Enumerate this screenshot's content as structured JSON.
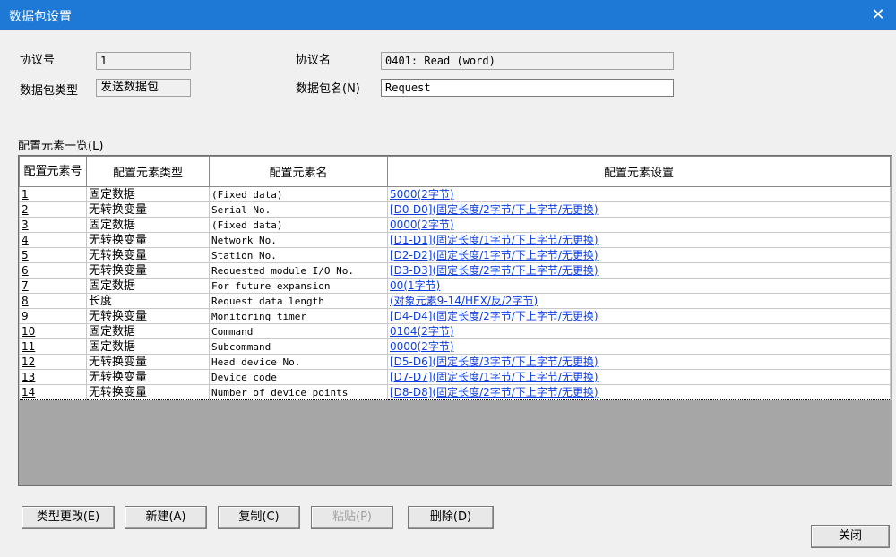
{
  "window": {
    "title": "数据包设置",
    "close_glyph": "✕"
  },
  "protocol_no": {
    "label": "协议号",
    "value": "1"
  },
  "protocol_name": {
    "label": "协议名",
    "value": "0401: Read (word)"
  },
  "packet_type": {
    "label": "数据包类型",
    "value": "发送数据包"
  },
  "packet_name": {
    "label": "数据包名(N)",
    "value": "Request"
  },
  "element_list": {
    "label": "配置元素一览(L)",
    "columns": [
      "配置元素号",
      "配置元素类型",
      "配置元素名",
      "配置元素设置"
    ],
    "rows": [
      {
        "no": "1",
        "type": "固定数据",
        "name": "(Fixed data)",
        "setting": "5000(2字节)"
      },
      {
        "no": "2",
        "type": "无转换变量",
        "name": "Serial No.",
        "setting": "[D0-D0](固定长度/2字节/下上字节/无更换)"
      },
      {
        "no": "3",
        "type": "固定数据",
        "name": "(Fixed data)",
        "setting": "0000(2字节)"
      },
      {
        "no": "4",
        "type": "无转换变量",
        "name": "Network No.",
        "setting": "[D1-D1](固定长度/1字节/下上字节/无更换)"
      },
      {
        "no": "5",
        "type": "无转换变量",
        "name": "Station No.",
        "setting": "[D2-D2](固定长度/1字节/下上字节/无更换)"
      },
      {
        "no": "6",
        "type": "无转换变量",
        "name": "Requested module I/O No.",
        "setting": "[D3-D3](固定长度/2字节/下上字节/无更换)"
      },
      {
        "no": "7",
        "type": "固定数据",
        "name": "For future expansion",
        "setting": "00(1字节)"
      },
      {
        "no": "8",
        "type": "长度",
        "name": "Request data length",
        "setting": "(对象元素9-14/HEX/反/2字节)"
      },
      {
        "no": "9",
        "type": "无转换变量",
        "name": "Monitoring timer",
        "setting": "[D4-D4](固定长度/2字节/下上字节/无更换)"
      },
      {
        "no": "10",
        "type": "固定数据",
        "name": "Command",
        "setting": "0104(2字节)"
      },
      {
        "no": "11",
        "type": "固定数据",
        "name": "Subcommand",
        "setting": "0000(2字节)"
      },
      {
        "no": "12",
        "type": "无转换变量",
        "name": "Head device No.",
        "setting": "[D5-D6](固定长度/3字节/下上字节/无更换)"
      },
      {
        "no": "13",
        "type": "无转换变量",
        "name": "Device code",
        "setting": "[D7-D7](固定长度/1字节/下上字节/无更换)"
      },
      {
        "no": "14",
        "type": "无转换变量",
        "name": "Number of device points",
        "setting": "[D8-D8](固定长度/2字节/下上字节/无更换)"
      }
    ]
  },
  "buttons": {
    "change_type": "类型更改(E)",
    "new": "新建(A)",
    "copy": "复制(C)",
    "paste": "粘贴(P)",
    "delete": "删除(D)",
    "close": "关闭"
  },
  "colors": {
    "titlebar": "#1e78d6",
    "link": "#0f3ee0",
    "grid_empty": "#a6a6a6"
  }
}
